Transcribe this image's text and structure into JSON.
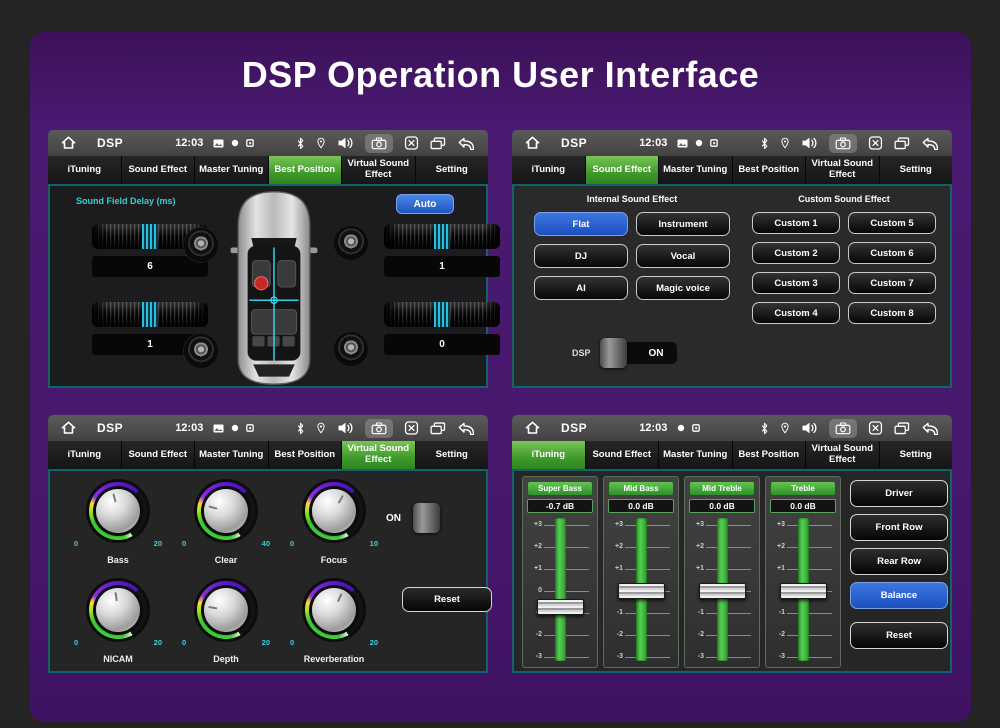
{
  "title": "DSP Operation User Interface",
  "statusbar": {
    "app_title": "DSP",
    "time": "12:03",
    "icons": [
      "home",
      "gallery",
      "record-dot",
      "stop-square",
      "bluetooth",
      "location",
      "volume",
      "camera",
      "close-app",
      "recent-apps",
      "back"
    ]
  },
  "tabs": [
    "iTuning",
    "Sound Effect",
    "Master Tuning",
    "Best Position",
    "Virtual Sound Effect",
    "Setting"
  ],
  "colors": {
    "board_purple": "#4a1a72",
    "panel_border_teal": "#0f646c",
    "active_tab_green": "#3f9a2b",
    "active_button_blue": "#2a63cf",
    "accent_cyan": "#35cfd4",
    "eq_green": "#3fae35"
  },
  "panels": {
    "best_position": {
      "active_tab": "Best Position",
      "section_label": "Sound Field Delay (ms)",
      "auto_button": "Auto",
      "delays": {
        "front_left": "6",
        "front_right": "1",
        "rear_left": "1",
        "rear_right": "0"
      }
    },
    "sound_effect": {
      "active_tab": "Sound Effect",
      "internal_title": "Internal Sound Effect",
      "internal_buttons": [
        "Flat",
        "Instrument",
        "DJ",
        "Vocal",
        "AI",
        "Magic voice"
      ],
      "internal_active": "Flat",
      "dsp_label": "DSP",
      "dsp_state": "ON",
      "custom_title": "Custom Sound Effect",
      "custom_buttons": [
        "Custom 1",
        "Custom 5",
        "Custom 2",
        "Custom 6",
        "Custom 3",
        "Custom 7",
        "Custom 4",
        "Custom 8"
      ]
    },
    "virtual_sound_effect": {
      "active_tab": "Virtual Sound Effect",
      "knobs": [
        {
          "name": "Bass",
          "min": "0",
          "max": "20"
        },
        {
          "name": "Clear",
          "min": "0",
          "max": "40"
        },
        {
          "name": "Focus",
          "min": "0",
          "max": "10"
        },
        {
          "name": "NICAM",
          "min": "0",
          "max": "20"
        },
        {
          "name": "Depth",
          "min": "0",
          "max": "20"
        },
        {
          "name": "Reverberation",
          "min": "0",
          "max": "20"
        }
      ],
      "toggle_state": "ON",
      "reset_button": "Reset"
    },
    "ituning": {
      "active_tab": "iTuning",
      "bands": [
        {
          "name": "Super Bass",
          "value": "-0.7 dB"
        },
        {
          "name": "Mid Bass",
          "value": "0.0 dB"
        },
        {
          "name": "Mid Treble",
          "value": "0.0 dB"
        },
        {
          "name": "Treble",
          "value": "0.0 dB"
        }
      ],
      "scale": [
        "+3",
        "+2",
        "+1",
        "0",
        "-1",
        "-2",
        "-3"
      ],
      "position_buttons": [
        "Driver",
        "Front Row",
        "Rear Row",
        "Balance",
        "Reset"
      ],
      "active_button": "Balance"
    }
  }
}
